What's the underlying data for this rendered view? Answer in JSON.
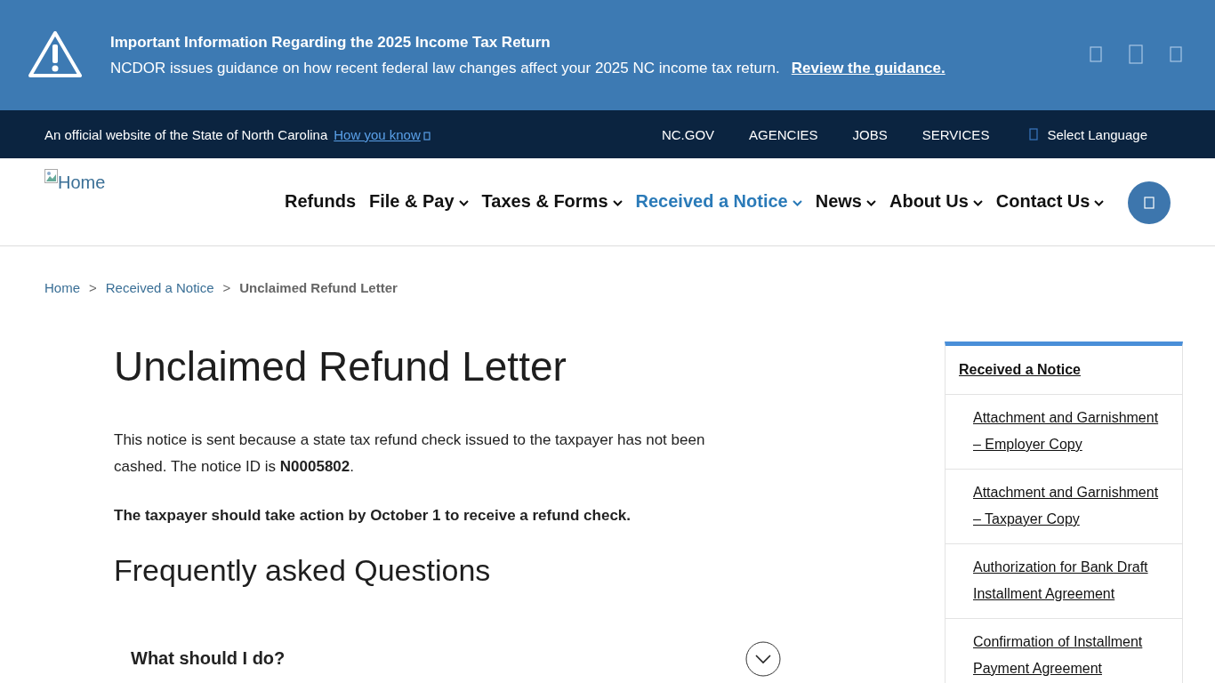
{
  "alert": {
    "title": "Important Information Regarding the 2025 Income Tax Return",
    "text": "NCDOR issues guidance on how recent federal law changes affect your 2025 NC income tax return.",
    "link": "Review the guidance."
  },
  "gov_bar": {
    "text": "An official website of the State of North Carolina",
    "link": "How you know",
    "links": [
      "NC.GOV",
      "AGENCIES",
      "JOBS",
      "SERVICES"
    ],
    "language": "Select Language"
  },
  "header": {
    "logo_alt": "Home",
    "nav": [
      {
        "label": "Refunds",
        "dropdown": false,
        "selected": false
      },
      {
        "label": "File & Pay",
        "dropdown": true,
        "selected": false
      },
      {
        "label": "Taxes & Forms",
        "dropdown": true,
        "selected": false
      },
      {
        "label": "Received a Notice",
        "dropdown": true,
        "selected": true
      },
      {
        "label": "News",
        "dropdown": true,
        "selected": false
      },
      {
        "label": "About Us",
        "dropdown": true,
        "selected": false
      },
      {
        "label": "Contact Us",
        "dropdown": true,
        "selected": false
      }
    ]
  },
  "breadcrumb": [
    {
      "label": "Home",
      "current": false
    },
    {
      "separator": ">",
      "label": "Received a Notice",
      "current": false
    },
    {
      "separator": ">",
      "label": "Unclaimed Refund Letter",
      "current": true
    }
  ],
  "main": {
    "title": "Unclaimed Refund Letter",
    "intro": "This notice is sent because a state tax refund check issued to the taxpayer has not been cashed. The notice ID is **N0005802**.",
    "action": "The taxpayer should take action by October 1 to receive a refund check.",
    "faq_title": "Frequently asked Questions",
    "faq": [
      {
        "question": "What should I do?",
        "expanded": false
      }
    ]
  },
  "sidebar": {
    "title": "Received a Notice",
    "items": [
      "Attachment and Garnishment – Employer Copy",
      "Attachment and Garnishment – Taxpayer Copy",
      "Authorization for Bank Draft Installment Agreement",
      "Confirmation of Installment Payment Agreement"
    ]
  }
}
